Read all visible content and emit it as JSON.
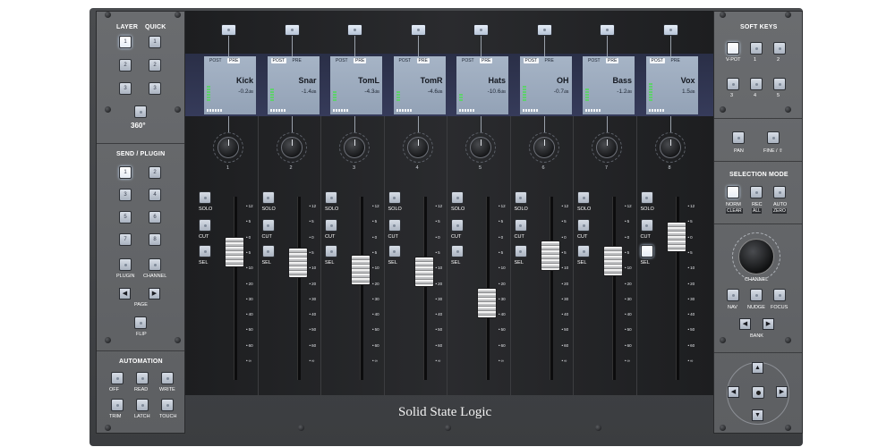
{
  "brand": "Solid State Logic",
  "left": {
    "layer_title": "LAYER",
    "quick_title": "QUICK",
    "layer_keys": [
      "1",
      "2",
      "3"
    ],
    "quick_keys": [
      "1",
      "2",
      "3"
    ],
    "view360": "360°",
    "send_title": "SEND / PLUGIN",
    "send_keys": [
      "1",
      "2",
      "3",
      "4",
      "5",
      "6",
      "7",
      "8"
    ],
    "plugin": "PLUGIN",
    "channel": "CHANNEL",
    "page": "PAGE",
    "flip": "FLIP",
    "automation_title": "AUTOMATION",
    "auto_keys": [
      "OFF",
      "READ",
      "WRITE",
      "TRIM",
      "LATCH",
      "TOUCH"
    ],
    "page_left_icon": "◀",
    "page_right_icon": "▶"
  },
  "strips": [
    {
      "name": "Kick",
      "value": "-0.2",
      "unit": "dB",
      "num": "1",
      "post": "POST",
      "pre": "PRE",
      "active": "pre",
      "fader": 0.3,
      "meter": 6
    },
    {
      "name": "Snar",
      "value": "-1.4",
      "unit": "dB",
      "num": "2",
      "post": "POST",
      "pre": "PRE",
      "active": "post",
      "fader": 0.36,
      "meter": 5
    },
    {
      "name": "TomL",
      "value": "-4.3",
      "unit": "dB",
      "num": "3",
      "post": "POST",
      "pre": "PRE",
      "active": "pre",
      "fader": 0.4,
      "meter": 4
    },
    {
      "name": "TomR",
      "value": "-4.6",
      "unit": "dB",
      "num": "4",
      "post": "POST",
      "pre": "PRE",
      "active": "pre",
      "fader": 0.41,
      "meter": 4
    },
    {
      "name": "Hats",
      "value": "-10.6",
      "unit": "dB",
      "num": "5",
      "post": "POST",
      "pre": "PRE",
      "active": "pre",
      "fader": 0.58,
      "meter": 3
    },
    {
      "name": "OH",
      "value": "-0.7",
      "unit": "dB",
      "num": "6",
      "post": "POST",
      "pre": "PRE",
      "active": "post",
      "fader": 0.32,
      "meter": 6
    },
    {
      "name": "Bass",
      "value": "-1.2",
      "unit": "dB",
      "num": "7",
      "post": "POST",
      "pre": "PRE",
      "active": "pre",
      "fader": 0.35,
      "meter": 5
    },
    {
      "name": "Vox",
      "value": "1.5",
      "unit": "dB",
      "num": "8",
      "post": "POST",
      "pre": "PRE",
      "active": "post",
      "fader": 0.22,
      "meter": 7
    }
  ],
  "strip_buttons": {
    "solo": "SOLO",
    "cut": "CUT",
    "sel": "SEL"
  },
  "fader_scale": [
    "12",
    "5",
    "0",
    "5",
    "10",
    "20",
    "30",
    "40",
    "50",
    "60",
    "∞"
  ],
  "right": {
    "soft_title": "SOFT KEYS",
    "soft_keys": [
      "V-POT",
      "1",
      "2",
      "3",
      "4",
      "5"
    ],
    "pan": "PAN",
    "fine": "FINE / ⇧",
    "selection_title": "SELECTION MODE",
    "norm": "NORM",
    "clear": "CLEAR",
    "rec": "REC",
    "all": "ALL",
    "auto": "AUTO",
    "zero": "ZERO",
    "channel": "CHANNEL",
    "nav": "NAV",
    "nudge": "NUDGE",
    "focus": "FOCUS",
    "bank": "BANK",
    "bank_left_icon": "◀",
    "bank_right_icon": "▶",
    "up_icon": "▲",
    "down_icon": "▼",
    "left_icon": "◀",
    "right_icon": "▶"
  }
}
